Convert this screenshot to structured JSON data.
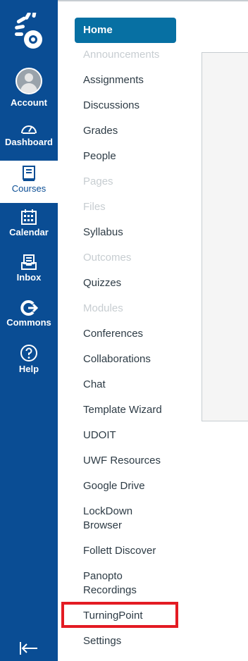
{
  "global_nav": {
    "logo": "canvas-logo",
    "items": [
      {
        "label": "Account",
        "icon": "avatar"
      },
      {
        "label": "Dashboard",
        "icon": "dashboard-icon"
      },
      {
        "label": "Courses",
        "icon": "courses-icon",
        "active": true
      },
      {
        "label": "Calendar",
        "icon": "calendar-icon"
      },
      {
        "label": "Inbox",
        "icon": "inbox-icon"
      },
      {
        "label": "Commons",
        "icon": "commons-icon"
      },
      {
        "label": "Help",
        "icon": "help-icon"
      }
    ],
    "collapse_icon": "collapse-icon",
    "colors": {
      "background": "#0a4d94",
      "text": "#ffffff"
    }
  },
  "course_nav": {
    "items": [
      {
        "label": "Home",
        "active": true
      },
      {
        "label": "Announcements",
        "disabled": true
      },
      {
        "label": "Assignments"
      },
      {
        "label": "Discussions"
      },
      {
        "label": "Grades"
      },
      {
        "label": "People"
      },
      {
        "label": "Pages",
        "disabled": true
      },
      {
        "label": "Files",
        "disabled": true
      },
      {
        "label": "Syllabus"
      },
      {
        "label": "Outcomes",
        "disabled": true
      },
      {
        "label": "Quizzes"
      },
      {
        "label": "Modules",
        "disabled": true
      },
      {
        "label": "Conferences"
      },
      {
        "label": "Collaborations"
      },
      {
        "label": "Chat"
      },
      {
        "label": "Template Wizard"
      },
      {
        "label": "UDOIT"
      },
      {
        "label": "UWF Resources"
      },
      {
        "label": "Google Drive"
      },
      {
        "label": "LockDown Browser"
      },
      {
        "label": "Follett Discover"
      },
      {
        "label": "Panopto Recordings"
      },
      {
        "label": "TurningPoint",
        "highlighted": true
      },
      {
        "label": "Settings"
      }
    ],
    "colors": {
      "active_bg": "#0770a3",
      "text": "#2d3b45",
      "disabled": "#c7cdd1",
      "highlight": "#e31b23"
    }
  }
}
